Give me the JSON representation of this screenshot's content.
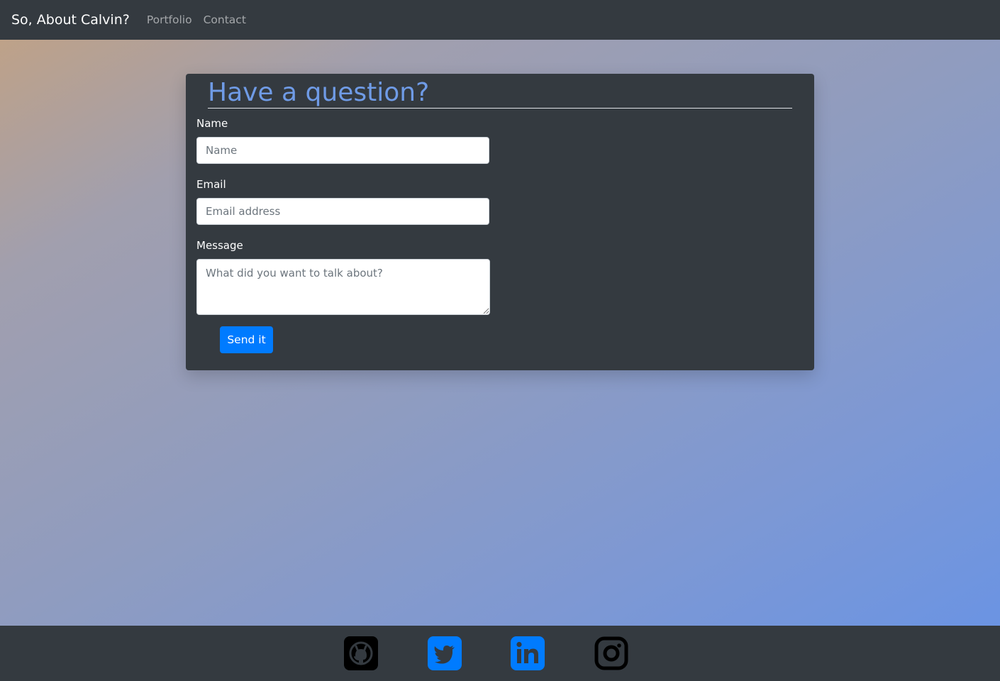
{
  "nav": {
    "brand": "So, About Calvin?",
    "links": [
      {
        "label": "Portfolio"
      },
      {
        "label": "Contact"
      }
    ]
  },
  "form": {
    "title": "Have a question?",
    "name": {
      "label": "Name",
      "placeholder": "Name",
      "value": ""
    },
    "email": {
      "label": "Email",
      "placeholder": "Email address",
      "value": ""
    },
    "message": {
      "label": "Message",
      "placeholder": "What did you want to talk about?",
      "value": ""
    },
    "submit_label": "Send it"
  },
  "footer": {
    "social": [
      {
        "icon": "github-icon",
        "color": "#000000"
      },
      {
        "icon": "twitter-icon",
        "color": "#007bff"
      },
      {
        "icon": "linkedin-icon",
        "color": "#007bff"
      },
      {
        "icon": "instagram-icon",
        "color": "#000000"
      }
    ]
  },
  "colors": {
    "nav_bg": "#343a40",
    "card_bg": "#343a40",
    "title": "#6f9be6",
    "primary": "#007bff"
  }
}
